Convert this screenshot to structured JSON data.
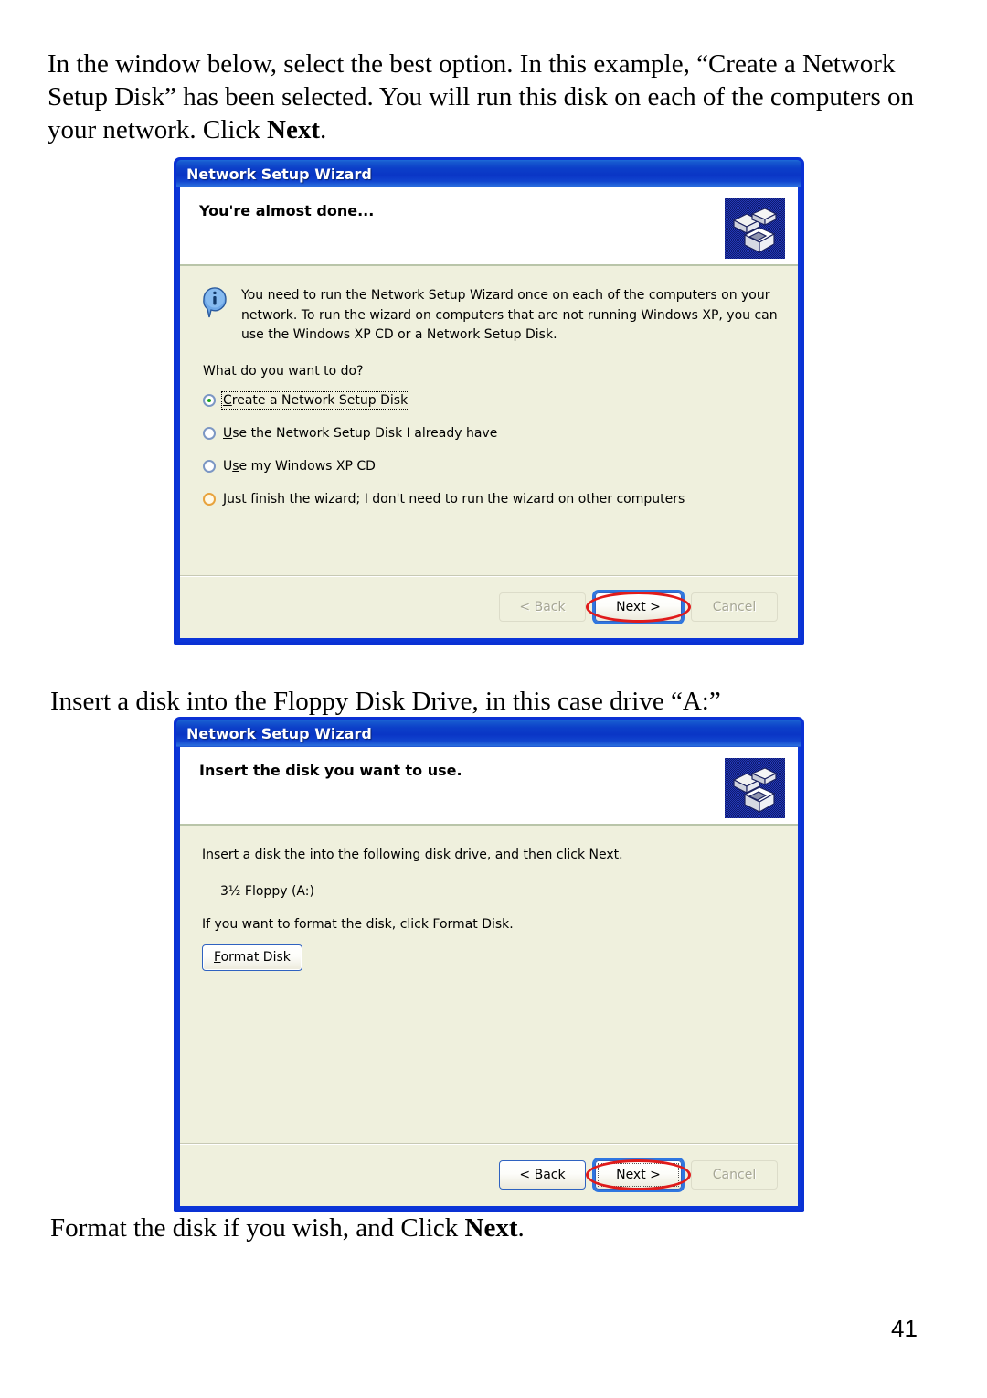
{
  "document": {
    "intro_paragraph_html": "In the window below, select the best option.  In this example, “Create a Network Setup Disk” has been selected.  You will run this disk on each of the computers on your network.  Click <b>Next</b>.",
    "mid_caption_html": "Insert a disk into the Floppy Disk Drive, in this case drive “A:”",
    "end_caption_html": "Format the disk if you wish, and Click <b>Next</b>.",
    "page_number": "41"
  },
  "colors": {
    "titlebar_blue": "#0c3fc9",
    "dialog_border_blue": "#0a31d4",
    "dialog_body": "#eff0dd",
    "header_white": "#ffffff",
    "header_rule_green": "#b9c5a9",
    "annotation_red": "#e01b1b",
    "radio_selected_green": "#18a318",
    "radio_hover_orange": "#e8a33d",
    "button_border_blue": "#2f62c0",
    "focus_ring_blue": "#2f76e0",
    "disabled_text": "#a6a694"
  },
  "dialog_almost_done": {
    "titlebar": {
      "title": "Network Setup Wizard"
    },
    "header": {
      "title": "You're almost done...",
      "icon": "network-computers-icon"
    },
    "body": {
      "info_icon": "info-icon",
      "info_text": "You need to run the Network Setup Wizard once on each of the computers on your network. To run the wizard on computers that are not running Windows XP, you can use the Windows XP CD or a Network Setup Disk.",
      "question": "What do you want to do?",
      "options": [
        {
          "label_html": "<u>C</u>reate a Network Setup Disk",
          "selected": true,
          "focused": true,
          "hover": false
        },
        {
          "label_html": "<u>U</u>se the Network Setup Disk I already have",
          "selected": false,
          "focused": false,
          "hover": false
        },
        {
          "label_html": "U<u>s</u>e my Windows XP CD",
          "selected": false,
          "focused": false,
          "hover": false
        },
        {
          "label_html": "<u>J</u>ust finish the wizard; I don't need to run the wizard on other computers",
          "selected": false,
          "focused": false,
          "hover": true
        }
      ]
    },
    "footer": {
      "back_label": "< Back",
      "back_enabled": false,
      "next_label": "Next >",
      "next_state": "default-focus",
      "next_annotated": true,
      "cancel_label": "Cancel",
      "cancel_enabled": false
    }
  },
  "dialog_insert_disk": {
    "titlebar": {
      "title": "Network Setup Wizard"
    },
    "header": {
      "title": "Insert the disk you want to use.",
      "icon": "network-computers-icon"
    },
    "body": {
      "instruction": "Insert a disk the into the following disk drive, and then click Next.",
      "drive_label": "3½ Floppy (A:)",
      "format_hint": "If you want to format the disk, click Format Disk.",
      "format_button_label": "Format Disk"
    },
    "footer": {
      "back_label": "< Back",
      "back_enabled": true,
      "next_label": "Next >",
      "next_state": "dotted-focus",
      "next_annotated": true,
      "cancel_label": "Cancel",
      "cancel_enabled": false
    }
  }
}
